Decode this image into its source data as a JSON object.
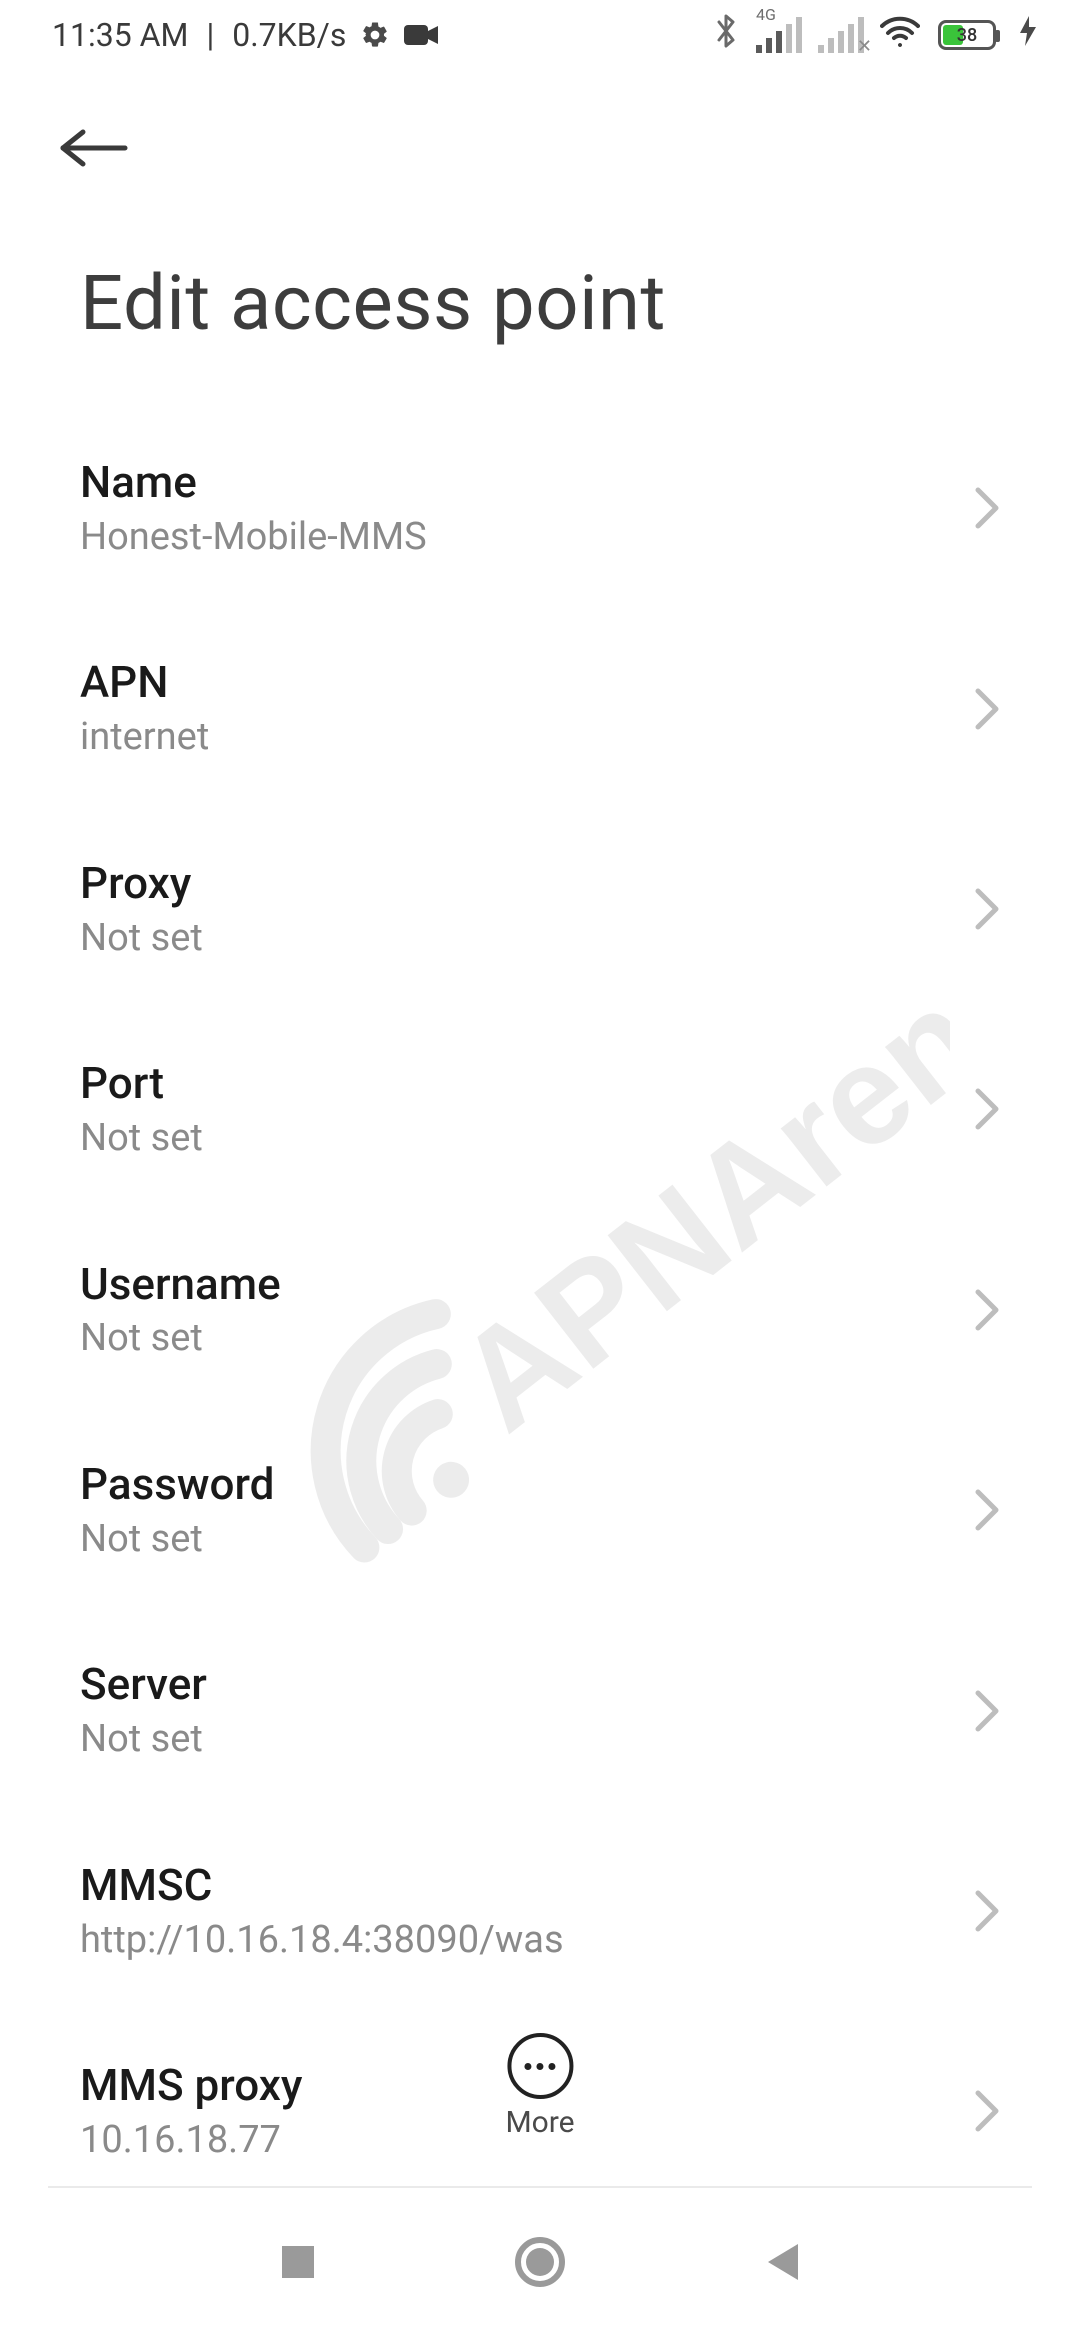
{
  "status": {
    "time": "11:35 AM",
    "net_speed": "0.7KB/s",
    "network_label": "4G",
    "battery_percent": "38"
  },
  "header": {
    "title": "Edit access point"
  },
  "settings": [
    {
      "label": "Name",
      "value": "Honest-Mobile-MMS"
    },
    {
      "label": "APN",
      "value": "internet"
    },
    {
      "label": "Proxy",
      "value": "Not set"
    },
    {
      "label": "Port",
      "value": "Not set"
    },
    {
      "label": "Username",
      "value": "Not set"
    },
    {
      "label": "Password",
      "value": "Not set"
    },
    {
      "label": "Server",
      "value": "Not set"
    },
    {
      "label": "MMSC",
      "value": "http://10.16.18.4:38090/was"
    },
    {
      "label": "MMS proxy",
      "value": "10.16.18.77"
    }
  ],
  "more_label": "More",
  "watermark_text": "APNArena"
}
